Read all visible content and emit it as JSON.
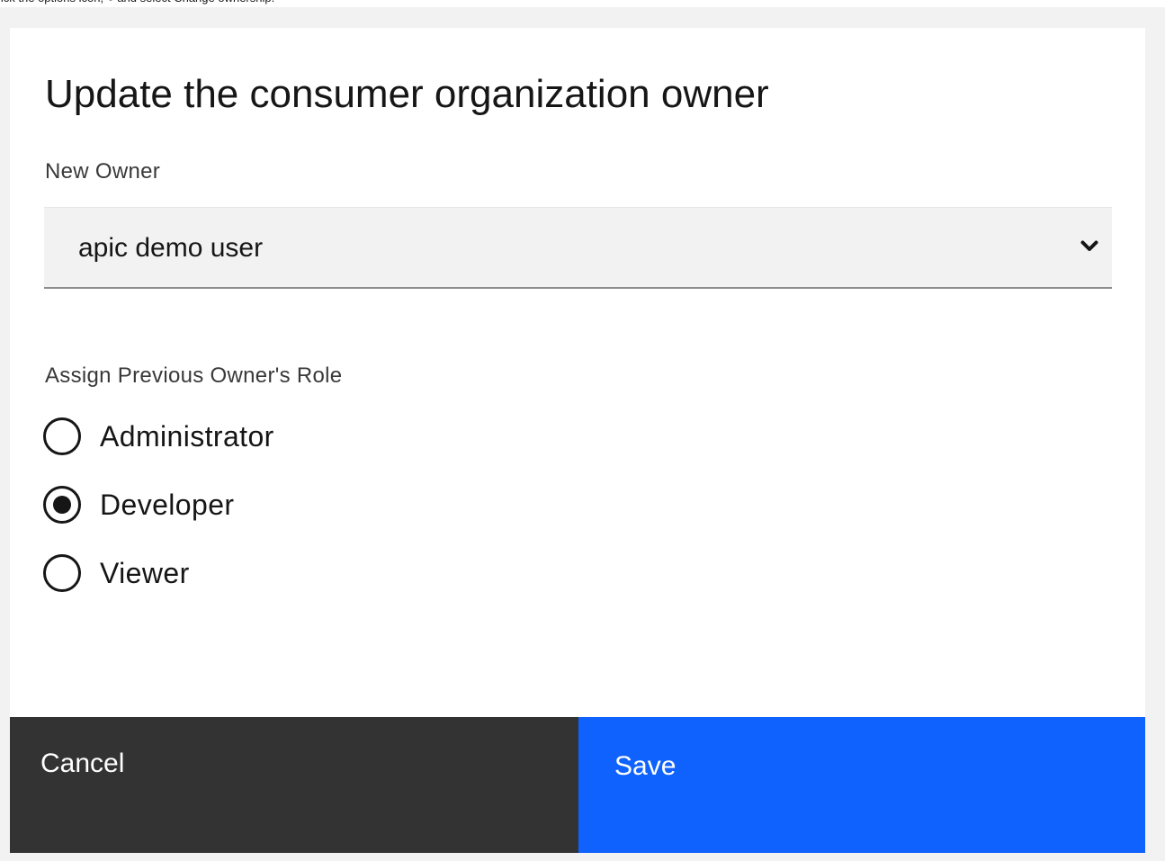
{
  "caption": {
    "before_icon": "lick the options icon,",
    "after_icon": "and select Change ownership."
  },
  "modal": {
    "title": "Update the consumer organization owner",
    "new_owner": {
      "label": "New Owner",
      "selected_value": "apic demo user",
      "icon": "chevron-down-icon"
    },
    "role": {
      "label": "Assign Previous Owner's Role",
      "options": [
        {
          "label": "Administrator",
          "checked": false
        },
        {
          "label": "Developer",
          "checked": true
        },
        {
          "label": "Viewer",
          "checked": false
        }
      ]
    },
    "buttons": {
      "cancel_label": "Cancel",
      "save_label": "Save"
    }
  },
  "colors": {
    "primary": "#0f62fe",
    "secondary": "#333333",
    "page_background": "#f2f2f2",
    "text": "#161616"
  }
}
